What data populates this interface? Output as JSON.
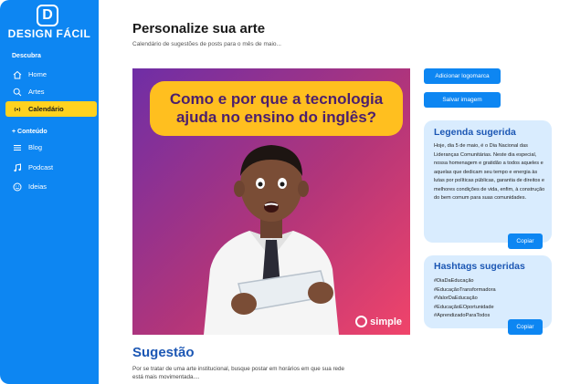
{
  "brand": {
    "logo_letter": "D",
    "name": "DESIGN FÁCIL"
  },
  "sidebar": {
    "section1": "Descubra",
    "items": [
      {
        "label": "Home",
        "icon": "home-icon"
      },
      {
        "label": "Artes",
        "icon": "search-icon"
      },
      {
        "label": "Calendário",
        "icon": "broadcast-icon",
        "active": true
      }
    ],
    "section2": "+ Conteúdo",
    "items2": [
      {
        "label": "Blog",
        "icon": "list-icon"
      },
      {
        "label": "Podcast",
        "icon": "music-icon"
      },
      {
        "label": "Ideias",
        "icon": "smile-icon"
      }
    ]
  },
  "header": {
    "title": "Personalize sua arte",
    "subtitle": "Calendário de sugestões de posts para o mês de maio..."
  },
  "art": {
    "headline": "Como e por que a tecnologia ajuda no ensino do inglês?",
    "brand": "simple"
  },
  "actions": {
    "add_logo": "Adicionar logomarca",
    "save_image": "Salvar imagem"
  },
  "caption": {
    "title": "Legenda sugerida",
    "text": "Hoje, dia 5 de maio, é o Dia Nacional das Lideranças Comunitárias. Neste dia especial, nossa homenagem e gratidão a todos aqueles e aquelas que dedicam seu tempo e energia às lutas por políticas públicas, garantia de direitos e melhores condições de vida, enfim, à construção do bem comum para suas comunidades.",
    "copy": "Copiar"
  },
  "hashtags": {
    "title": "Hashtags sugeridas",
    "tags": [
      "#DiaDaEducação",
      "#EducaçãoTransformadora",
      "#ValorDaEducação",
      "#EducaçãoEOportunidade",
      "#AprendizadoParaTodos"
    ],
    "copy": "Copiar"
  },
  "suggestion": {
    "title": "Sugestão",
    "text": "Por se tratar de uma arte institucional, busque postar em horários em que sua rede está mais movimentada...."
  },
  "colors": {
    "primary": "#0d86f2",
    "active": "#ffd21f",
    "card": "#d9ecfe",
    "heading_blue": "#1c57b4"
  }
}
